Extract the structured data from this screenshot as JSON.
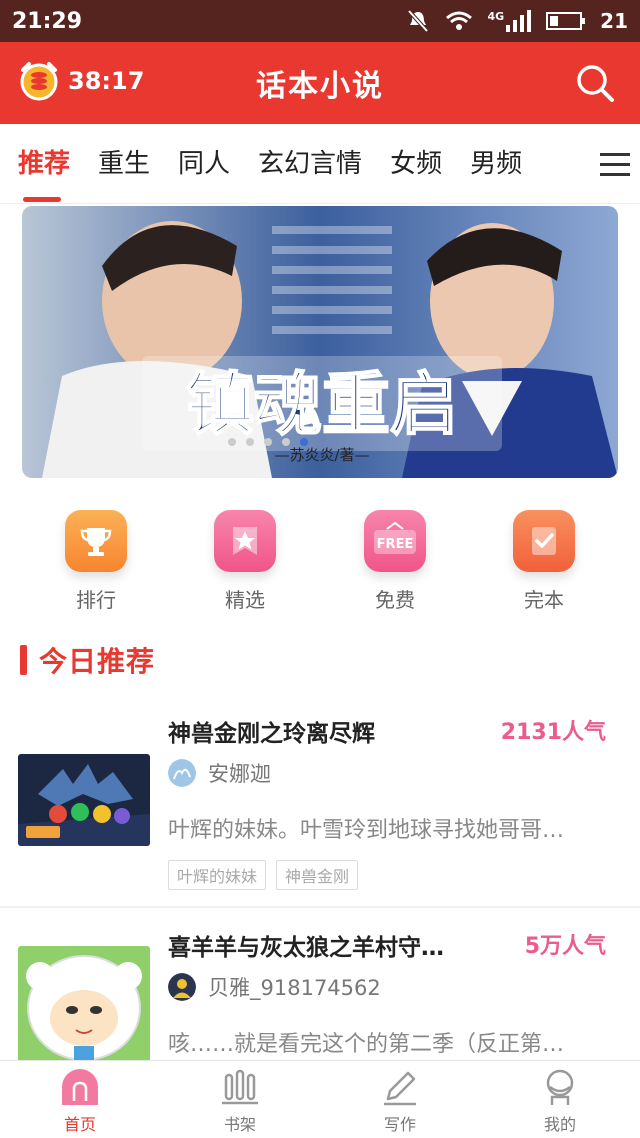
{
  "status_bar": {
    "time": "21:29",
    "network": "4G",
    "battery": "21"
  },
  "app_bar": {
    "timer": "38:17",
    "title": "话本小说"
  },
  "tabs": [
    "推荐",
    "重生",
    "同人",
    "玄幻言情",
    "女频",
    "男频"
  ],
  "banner": {
    "title": "镇魂重启",
    "author": "—苏炎炎/著—"
  },
  "quick_links": [
    {
      "label": "排行",
      "icon": "trophy-icon",
      "color": "#f7852f"
    },
    {
      "label": "精选",
      "icon": "star-icon",
      "color": "#f0558a"
    },
    {
      "label": "免费",
      "icon": "free-icon",
      "color": "#f0558a"
    },
    {
      "label": "完本",
      "icon": "check-note-icon",
      "color": "#f2603a"
    }
  ],
  "section": {
    "title": "今日推荐"
  },
  "books": [
    {
      "title": "神兽金刚之玲离尽辉",
      "popularity": "2131人气",
      "author": "安娜迦",
      "description": "叶辉的妹妹。叶雪玲到地球寻找她哥哥…",
      "tags": [
        "叶辉的妹妹",
        "神兽金刚"
      ]
    },
    {
      "title": "喜羊羊与灰太狼之羊村守…",
      "popularity": "5万人气",
      "author": "贝雅_918174562",
      "description": "咳……就是看完这个的第二季（反正第…",
      "tags": []
    }
  ],
  "bottom_nav": [
    {
      "label": "首页",
      "icon": "home-icon"
    },
    {
      "label": "书架",
      "icon": "bookshelf-icon"
    },
    {
      "label": "写作",
      "icon": "pen-icon"
    },
    {
      "label": "我的",
      "icon": "profile-icon"
    }
  ],
  "colors": {
    "accent": "#e8382f",
    "status_bar": "#55241e",
    "popularity": "#ea5b8e"
  }
}
